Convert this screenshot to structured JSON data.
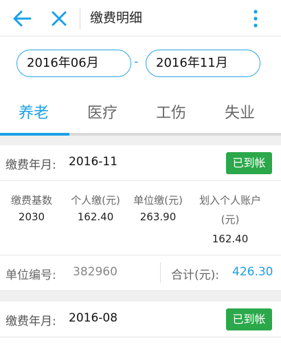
{
  "header": {
    "title": "缴费明细"
  },
  "range": {
    "from": "2016年06月",
    "separator": "-",
    "to": "2016年11月"
  },
  "tabs": [
    {
      "label": "养老"
    },
    {
      "label": "医疗"
    },
    {
      "label": "工伤"
    },
    {
      "label": "失业"
    }
  ],
  "labels": {
    "month": "缴费年月:",
    "base": "缴费基数",
    "personal": "个人缴(元)",
    "unit": "单位缴(元)",
    "account_line1": "划入个人账户",
    "account_line2": "(元)",
    "unit_id": "单位编号:",
    "total": "合计(元):"
  },
  "records": [
    {
      "month": "2016-11",
      "status": "已到帐",
      "base": "2030",
      "personal": "162.40",
      "unit": "263.90",
      "account": "162.40",
      "unit_id": "382960",
      "total": "426.30"
    },
    {
      "month": "2016-08",
      "status": "已到帐"
    }
  ],
  "colors": {
    "accent": "#1aa0e8",
    "success": "#2aa84a"
  }
}
